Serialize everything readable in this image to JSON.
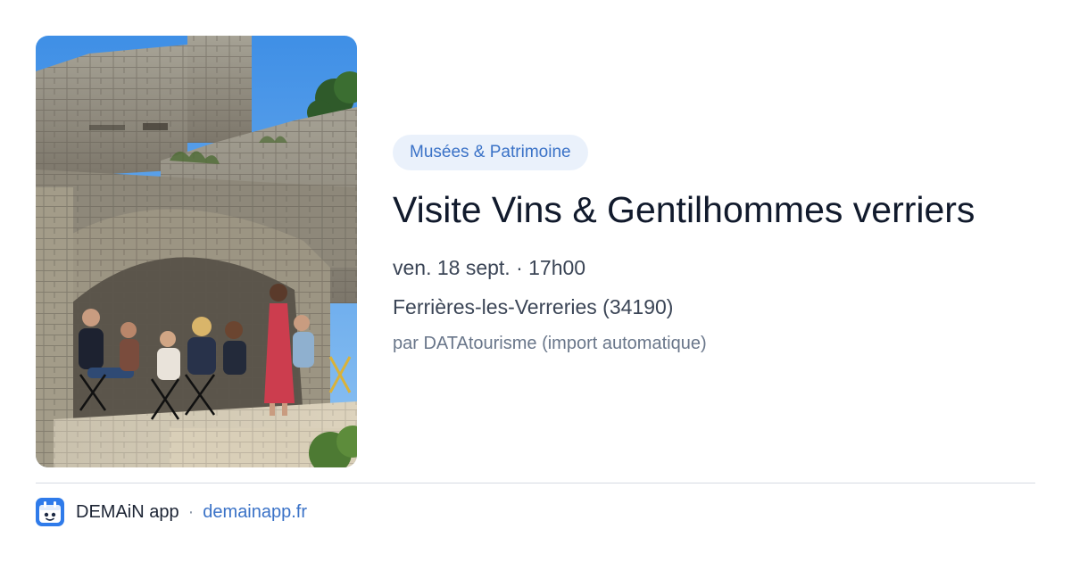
{
  "event": {
    "category": "Musées & Patrimoine",
    "title": "Visite Vins & Gentilhommes verriers",
    "datetime": "ven. 18 sept. · 17h00",
    "location": "Ferrières-les-Verreries (34190)",
    "source": "par DATAtourisme (import automatique)",
    "photo_alt": "Visite Vins & Gentilhommes verriers"
  },
  "footer": {
    "app_name": "DEMAiN app",
    "separator": "·",
    "domain": "demainapp.fr"
  },
  "colors": {
    "accent": "#3a72c7",
    "badge_bg": "#eaf1fb",
    "title": "#111a2c",
    "body_text": "#3b4556",
    "muted_text": "#69768a",
    "divider": "#d6dbe2",
    "logo_bg": "#2f7bea"
  },
  "icons": {
    "app_logo": "calendar-face-logo"
  }
}
